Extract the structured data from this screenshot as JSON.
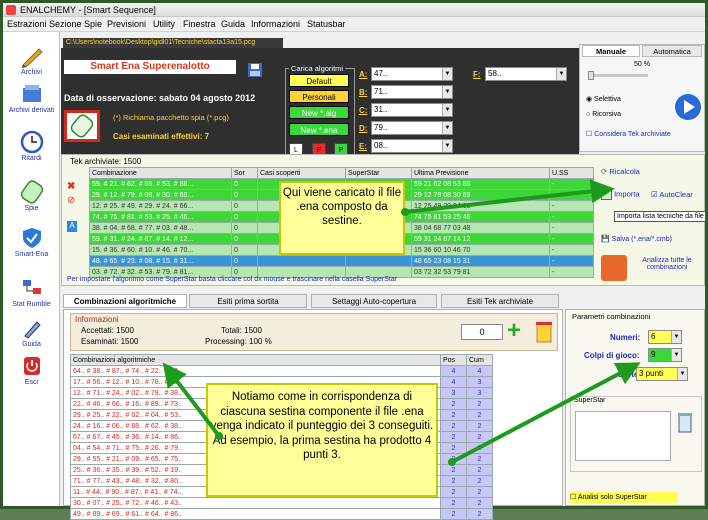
{
  "window": {
    "title": "ENALCHEMY - [Smart Sequence]"
  },
  "menu": [
    "Estrazioni",
    "Sezione Spie",
    "Previsioni",
    "Utility",
    "Finestra",
    "Guida",
    "Informazioni",
    "Statusbar"
  ],
  "sidebar": [
    {
      "label": "Archivi",
      "icon": "pencil-icon"
    },
    {
      "label": "Archivi derivati",
      "icon": "archive-icon"
    },
    {
      "label": "Ritardi",
      "icon": "clock-icon"
    },
    {
      "label": "Spie",
      "icon": "spy-glass-icon"
    },
    {
      "label": "Smart-Ena",
      "icon": "shield-icon"
    },
    {
      "label": "Stat Rumble",
      "icon": "network-icon"
    },
    {
      "label": "Guida",
      "icon": "guide-icon"
    },
    {
      "label": "Esci",
      "icon": "power-icon"
    }
  ],
  "header": {
    "path": "C:\\Users\\notebook\\Desktop\\gidl01\\Tecniche\\stacta13a15.pcg",
    "title": "Smart Ena Superenalotto",
    "date_label": "Data di osservazione:",
    "date_value": "sabato 04 agosto 2012",
    "richiama": "(*) Richiama pacchetto spia (*.pcg)",
    "casi_label": "Casi esaminati effettivi:",
    "casi_value": "7"
  },
  "carica": {
    "title": "Carica algoritmi",
    "buttons": [
      "Default",
      "Personali",
      "New *.alg",
      "New *.ena"
    ],
    "small": [
      "L",
      "F",
      "P"
    ]
  },
  "combos": [
    {
      "label": "A:",
      "value": "47.."
    },
    {
      "label": "B:",
      "value": "71.."
    },
    {
      "label": "C:",
      "value": "31.."
    },
    {
      "label": "D:",
      "value": "79.."
    },
    {
      "label": "E:",
      "value": "08.."
    },
    {
      "label": "F:",
      "value": "58.."
    }
  ],
  "mode_tabs": {
    "manuale": "Manuale",
    "automatica": "Automatica",
    "percent": "50 %",
    "selettiva": "Selettiva",
    "ricorsiva": "Ricorsiva",
    "considera": "Considera Tek archiviate"
  },
  "tek": {
    "title": "Tek archiviate: 1500",
    "columns": [
      "Combinazione",
      "Sor",
      "Casi scoperti",
      "SuperStar",
      "Ultima Previsione",
      "U.SS"
    ],
    "rows": [
      {
        "comb": "59. # 21. # 62. # 08. # 53. # 88...",
        "sor": "0",
        "prev": "59 21 62 08 53 88",
        "uss": "-"
      },
      {
        "comb": "29. # 12. # 79. # 08. # 30. # 69...",
        "sor": "0",
        "prev": "29 12 79 08 30 69",
        "uss": "-"
      },
      {
        "comb": "12. # 25. # 49. # 29. # 24. # 66...",
        "sor": "0",
        "prev": "12 25 49 29 24 66",
        "uss": "-"
      },
      {
        "comb": "74. # 75. # 81. # 53. # 25. # 46...",
        "sor": "0",
        "prev": "74 75 81 53 25 46",
        "uss": "-"
      },
      {
        "comb": "38. # 04. # 68. # 77. # 03. # 48...",
        "sor": "0",
        "prev": "38 04 68 77 03 48",
        "uss": "-"
      },
      {
        "comb": "59. # 31. # 24. # 87. # 14. # 12...",
        "sor": "0",
        "prev": "59 31 24 87 14 12",
        "uss": "-"
      },
      {
        "comb": "15. # 36. # 60. # 10. # 46. # 70...",
        "sor": "0",
        "prev": "15 36 60 10 46 70",
        "uss": "-"
      },
      {
        "comb": "48. # 65. # 23. # 08. # 15. # 31...",
        "sor": "0",
        "prev": "48 65 23 08 15 31",
        "uss": "-"
      },
      {
        "comb": "03. # 72. # 32. # 53. # 79. # 81...",
        "sor": "0",
        "prev": "03 72 32 53 79 81",
        "uss": "-"
      }
    ],
    "hint": "Per impostare l'algoritmo come SuperStar basta cliccare col dx mouse e trascinare nella casella SuperStar",
    "tools": {
      "ricalcola": "Ricalcola",
      "importa": "Importa",
      "autoclear": "AutoClear",
      "salva": "Salva (*.ena/*.cmb)",
      "analizza": "Analizza tutte le combinazioni"
    },
    "tooltip": "Importa lista tecniche da file (*.ena)"
  },
  "bottom_tabs": [
    "Combinazioni algoritmiche",
    "Esiti prima sortita",
    "Settaggi Auto-copertura",
    "Esiti Tek archiviate"
  ],
  "info": {
    "title": "Informazioni",
    "accettati_label": "Accettati:",
    "accettati": "1500",
    "esaminati_label": "Esaminati:",
    "esaminati": "1500",
    "totali_label": "Totali:",
    "totali": "1500",
    "processing_label": "Processing:",
    "processing": "100 %",
    "counter": "0"
  },
  "combos_table": {
    "columns": [
      "Combinazioni algoritmiche",
      "Pos",
      "Cum"
    ],
    "rows": [
      {
        "comb": "64.. # 38.. # 87.. # 74.. # 22.. # 62..",
        "pos": "4",
        "cum": "4"
      },
      {
        "comb": "17.. # 56.. # 12.. # 10.. # 78.. # 26..",
        "pos": "4",
        "cum": "3"
      },
      {
        "comb": "12.. # 71.. # 24.. # 02.. # 79.. # 38..",
        "pos": "3",
        "cum": "3"
      },
      {
        "comb": "22.. # 46.. # 66.. # 16.. # 89.. # 73..",
        "pos": "2",
        "cum": "2"
      },
      {
        "comb": "29.. # 25.. # 22.. # 02.. # 04.. # 53..",
        "pos": "2",
        "cum": "2"
      },
      {
        "comb": "24.. # 16.. # 06.. # 88.. # 62.. # 38..",
        "pos": "2",
        "cum": "2"
      },
      {
        "comb": "67.. # 67.. # 45.. # 36.. # 14.. # 86..",
        "pos": "2",
        "cum": "2"
      },
      {
        "comb": "04.. # 54.. # 71.. # 75.. # 26.. # 79..",
        "pos": "2",
        "cum": "2"
      },
      {
        "comb": "29.. # 55.. # 21.. # 09.. # 65.. # 75..",
        "pos": "2",
        "cum": "2"
      },
      {
        "comb": "25.. # 36.. # 35.. # 39.. # 52.. # 19..",
        "pos": "2",
        "cum": "2"
      },
      {
        "comb": "71.. # 77.. # 43.. # 48.. # 32.. # 80..",
        "pos": "2",
        "cum": "2"
      },
      {
        "comb": "11.. # 44.. # 90.. # 87.. # 41.. # 74..",
        "pos": "2",
        "cum": "2"
      },
      {
        "comb": "30.. # 07.. # 25.. # 72.. # 46.. # 43..",
        "pos": "2",
        "cum": "2"
      },
      {
        "comb": "49.. # 89.. # 69.. # 61.. # 64.. # 86..",
        "pos": "2",
        "cum": "2"
      }
    ]
  },
  "params": {
    "title": "Parametri combinazioni",
    "numeri_label": "Numeri:",
    "numeri": "6",
    "colpi_label": "Colpi di gioco:",
    "colpi": "9",
    "sorte_label": "Sorte:",
    "sorte": "3 punti",
    "superstar": "SuperStar",
    "analisi": "Analisi solo SuperStar"
  },
  "callouts": {
    "one": "Qui viene caricato il file .ena composto da sestine.",
    "two": "Notiamo come in corrispondenza di ciascuna sestina componente il file .ena venga indicato il punteggio dei 3 conseguiti. Ad esempio, la prima sestina ha prodotto 4 punti 3."
  },
  "colors": {
    "accent": "#d43a1c",
    "yellow": "#ffd23a",
    "green": "#3fd63a",
    "arrow": "#1e9a1e"
  }
}
